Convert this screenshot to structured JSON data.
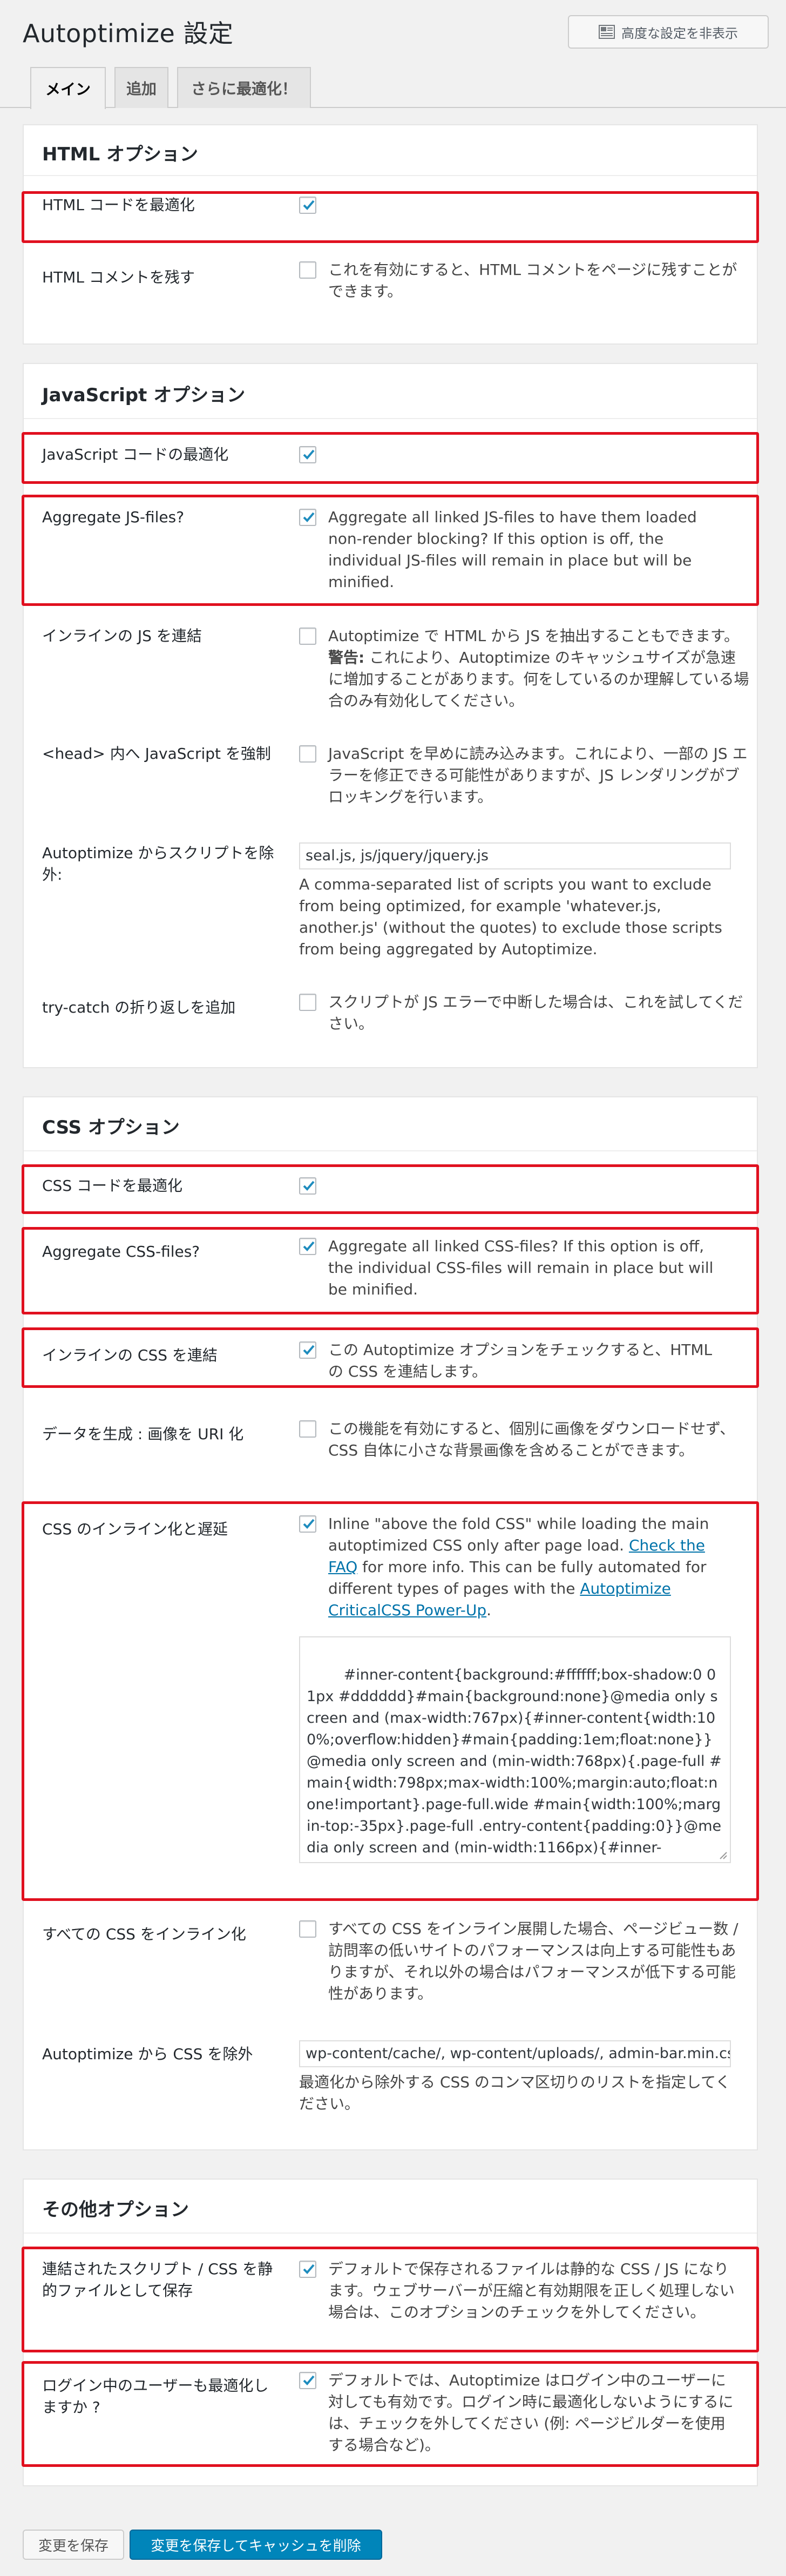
{
  "page": {
    "title": "Autoptimize 設定",
    "toggle_button_label": "高度な設定を非表示"
  },
  "tabs": [
    {
      "label": "メイン",
      "active": true
    },
    {
      "label": "追加",
      "active": false
    },
    {
      "label": "さらに最適化！",
      "active": false
    }
  ],
  "html_section": {
    "title": "HTML オプション",
    "rows": [
      {
        "label": "HTML コードを最適化",
        "checked": true,
        "desc": ""
      },
      {
        "label": "HTML コメントを残す",
        "checked": false,
        "desc": "これを有効にすると、HTML コメントをページに残すことができます。"
      }
    ]
  },
  "js_section": {
    "title": "JavaScript オプション",
    "optimize_label": "JavaScript コードの最適化",
    "aggregate_label": "Aggregate JS-files?",
    "aggregate_desc": "Aggregate all linked JS-files to have them loaded non-render blocking? If this option is off, the individual JS-files will remain in place but will be minified.",
    "inline_label": "インラインの JS を連結",
    "inline_desc_1": "Autoptimize で HTML から JS を抽出することもできます。",
    "inline_desc_warning": "警告:",
    "inline_desc_2": " これにより、Autoptimize のキャッシュサイズが急速に増加することがあります。何をしているのか理解している場合のみ有効化してください。",
    "forcehead_label": "<head> 内へ JavaScript を強制",
    "forcehead_desc": "JavaScript を早めに読み込みます。これにより、一部の JS エラーを修正できる可能性がありますが、JS レンダリングがブロッキングを行います。",
    "exclude_label": "Autoptimize からスクリプトを除外:",
    "exclude_value": "seal.js, js/jquery/jquery.js",
    "exclude_desc": "A comma-separated list of scripts you want to exclude from being optimized, for example 'whatever.js, another.js' (without the quotes) to exclude those scripts from being aggregated by Autoptimize.",
    "trycatch_label": "try-catch の折り返しを追加",
    "trycatch_desc": "スクリプトが JS エラーで中断した場合は、これを試してください。"
  },
  "css_section": {
    "title": "CSS オプション",
    "optimize_label": "CSS コードを最適化",
    "aggregate_label": "Aggregate CSS-files?",
    "aggregate_desc": "Aggregate all linked CSS-files? If this option is off, the individual CSS-files will remain in place but will be minified.",
    "inline_label": "インラインの CSS を連結",
    "inline_desc": "この Autoptimize オプションをチェックすると、HTML の CSS を連結します。",
    "datauri_label": "データを生成 : 画像を URI 化",
    "datauri_desc": "この機能を有効にすると、個別に画像をダウンロードせず、CSS 自体に小さな背景画像を含めることができます。",
    "defer_label": "CSS のインライン化と遅延",
    "defer_desc_1": "Inline \"above the fold CSS\" while loading the main autoptimized CSS only after page load. ",
    "defer_link_1": "Check the FAQ",
    "defer_desc_2": " for more info. This can be fully automated for different types of pages with the ",
    "defer_link_2": "Autoptimize CriticalCSS Power-Up",
    "defer_desc_3": ".",
    "defer_css_value": "#inner-content{background:#ffffff;box-shadow:0 0 1px #dddddd}#main{background:none}@media only screen and (max-width:767px){#inner-content{width:100%;overflow:hidden}#main{padding:1em;float:none}}@media only screen and (min-width:768px){.page-full #main{width:798px;max-width:100%;margin:auto;float:none!important}.page-full.wide #main{width:100%;margin-top:-35px}.page-full .entry-content{padding:0}}@media only screen and (min-width:1166px){#inner-",
    "inlineall_label": "すべての CSS をインライン化",
    "inlineall_desc": "すべての CSS をインライン展開した場合、ページビュー数 / 訪問率の低いサイトのパフォーマンスは向上する可能性もありますが、それ以外の場合はパフォーマンスが低下する可能性があります。",
    "exclude_label": "Autoptimize から CSS を除外",
    "exclude_value": "wp-content/cache/, wp-content/uploads/, admin-bar.min.css, dashicons.min.css",
    "exclude_desc": "最適化から除外する CSS のコンマ区切りのリストを指定してください。"
  },
  "misc_section": {
    "title": "その他オプション",
    "static_label": "連結されたスクリプト / CSS を静的ファイルとして保存",
    "static_desc": "デフォルトで保存されるファイルは静的な CSS / JS になります。ウェブサーバーが圧縮と有効期限を正しく処理しない場合は、このオプションのチェックを外してください。",
    "loggedin_label": "ログイン中のユーザーも最適化しますか ?",
    "loggedin_desc": "デフォルトでは、Autoptimize はログイン中のユーザーに対しても有効です。ログイン時に最適化しないようにするには、チェックを外してください (例: ページビルダーを使用する場合など)。"
  },
  "footer": {
    "save_label": "変更を保存",
    "save_clear_label": "変更を保存してキャッシュを削除"
  },
  "colors": {
    "highlight": "#e0101f",
    "link": "#0073aa",
    "primary": "#0085ba",
    "check": "#1e8cbe"
  }
}
